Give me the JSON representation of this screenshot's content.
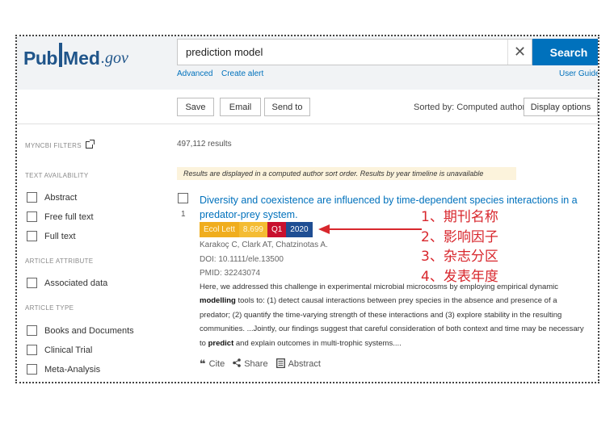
{
  "logo": {
    "pub": "Pub",
    "med": "Med",
    "gov": ".gov"
  },
  "search": {
    "value": "prediction model",
    "clear_icon": "close-icon",
    "button_label": "Search"
  },
  "links": {
    "advanced": "Advanced",
    "create_alert": "Create alert",
    "user_guide": "User Guide"
  },
  "toolbar": {
    "save": "Save",
    "email": "Email",
    "send_to": "Send to",
    "sorted_by": "Sorted by: Computed author",
    "display_options": "Display options"
  },
  "sidebar": {
    "myncbi_filters": "MYNCBI FILTERS",
    "text_availability": "TEXT AVAILABILITY",
    "text_filters": [
      "Abstract",
      "Free full text",
      "Full text"
    ],
    "article_attribute": "ARTICLE ATTRIBUTE",
    "attribute_filters": [
      "Associated data"
    ],
    "article_type": "ARTICLE TYPE",
    "type_filters": [
      "Books and Documents",
      "Clinical Trial",
      "Meta-Analysis"
    ]
  },
  "results": {
    "count": "497,112 results",
    "notice": "Results are displayed in a computed author sort order. Results by year timeline is unavailable",
    "items": [
      {
        "number": "1",
        "title": "Diversity and coexistence are influenced by time-dependent species interactions in a predator-prey system.",
        "badges": {
          "journal": "Ecol Lett",
          "impact_factor": "8.699",
          "quartile": "Q1",
          "year": "2020"
        },
        "authors": "Karakoç C, Clark AT, Chatzinotas A.",
        "doi": "DOI: 10.1111/ele.13500",
        "pmid": "PMID: 32243074",
        "snippet": {
          "part1": "Here, we addressed this challenge in experimental microbial microcosms by employing empirical dynamic ",
          "hl1": "modelling",
          "part2": " tools to: (1) detect causal interactions between prey species in the absence and presence of a predator; (2) quantify the time-varying strength of these interactions and (3) explore stability in the resulting communities. ...Jointly, our findings suggest that careful consideration of both context and time may be necessary to ",
          "hl2": "predict",
          "part3": " and explain outcomes in multi-trophic systems...."
        },
        "actions": {
          "cite": "Cite",
          "share": "Share",
          "abstract": "Abstract"
        }
      }
    ]
  },
  "annotations": [
    "1、期刊名称",
    "2、影响因子",
    "3、杂志分区",
    "4、发表年度"
  ],
  "colors": {
    "brand": "#20558a",
    "link": "#0071bc",
    "search_button": "#0071bc",
    "annotation": "#d8272d",
    "quartile": "#c8102e",
    "year": "#1f4e93",
    "journal": "#f0ad1d"
  }
}
